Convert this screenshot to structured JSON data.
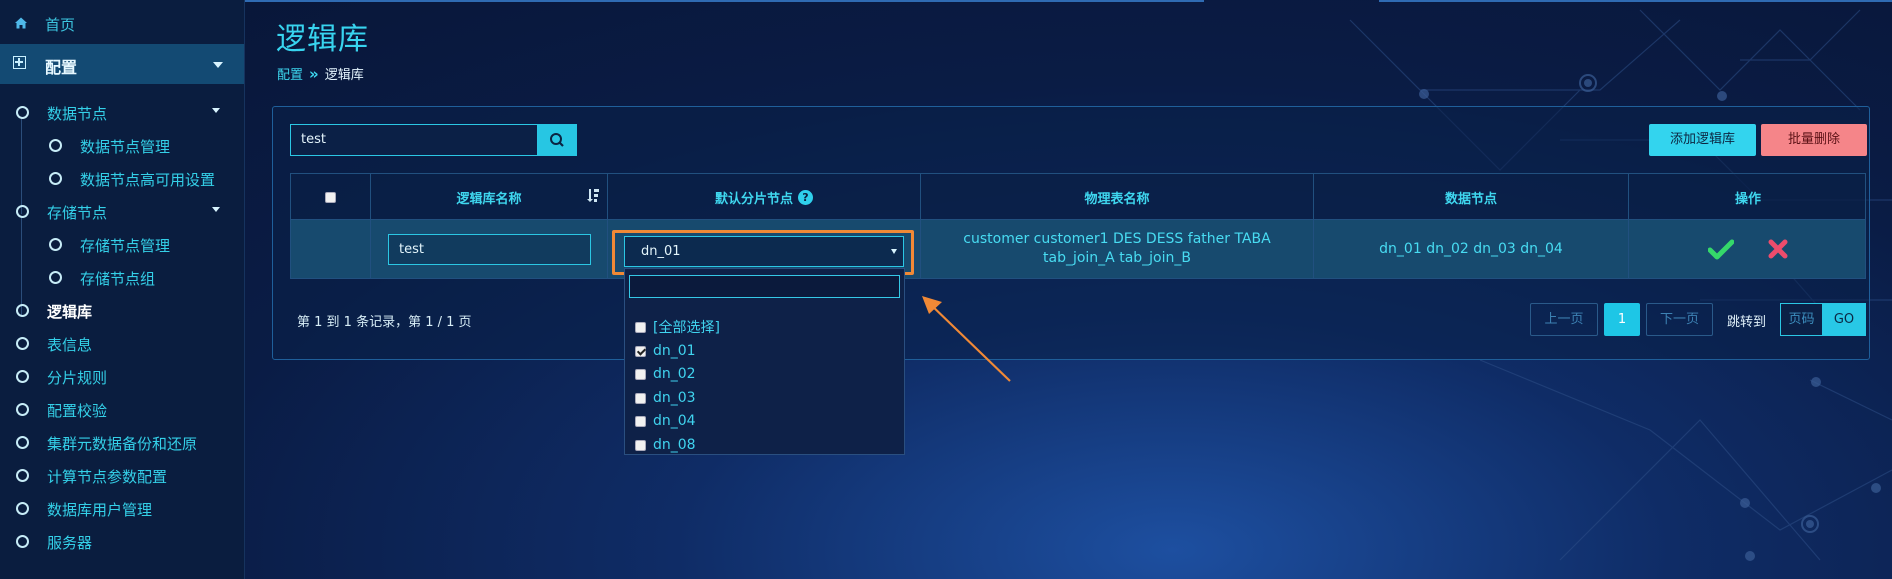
{
  "sidebar": {
    "home": "首页",
    "config": "配置",
    "items": [
      {
        "label": "数据节点",
        "level": 1,
        "expandable": true
      },
      {
        "label": "数据节点管理",
        "level": 2
      },
      {
        "label": "数据节点高可用设置",
        "level": 2
      },
      {
        "label": "存储节点",
        "level": 1,
        "expandable": true
      },
      {
        "label": "存储节点管理",
        "level": 2
      },
      {
        "label": "存储节点组",
        "level": 2
      },
      {
        "label": "逻辑库",
        "level": 1,
        "active": true
      },
      {
        "label": "表信息",
        "level": 1
      },
      {
        "label": "分片规则",
        "level": 1
      },
      {
        "label": "配置校验",
        "level": 1
      },
      {
        "label": "集群元数据备份和还原",
        "level": 1
      },
      {
        "label": "计算节点参数配置",
        "level": 1
      },
      {
        "label": "数据库用户管理",
        "level": 1
      },
      {
        "label": "服务器",
        "level": 1
      }
    ]
  },
  "header": {
    "title": "逻辑库",
    "breadcrumb": [
      "配置",
      "»",
      "逻辑库"
    ]
  },
  "toolbar": {
    "search_value": "test",
    "add_label": "添加逻辑库",
    "delete_label": "批量删除"
  },
  "table": {
    "columns": [
      "",
      "逻辑库名称",
      "默认分片节点",
      "物理表名称",
      "数据节点",
      "操作"
    ],
    "help_icon": "?",
    "row": {
      "name": "test",
      "default_node": "dn_01",
      "tables": "customer customer1 DES DESS father TABA tab_join_A tab_join_B",
      "nodes": "dn_01 dn_02 dn_03 dn_04"
    }
  },
  "dropdown": {
    "search_value": "",
    "options": [
      {
        "label": "[全部选择]",
        "checked": false
      },
      {
        "label": "dn_01",
        "checked": true
      },
      {
        "label": "dn_02",
        "checked": false
      },
      {
        "label": "dn_03",
        "checked": false
      },
      {
        "label": "dn_04",
        "checked": false
      },
      {
        "label": "dn_08",
        "checked": false
      }
    ]
  },
  "footer": {
    "records": "第 1 到 1 条记录，第 1 / 1 页",
    "prev": "上一页",
    "current": "1",
    "next": "下一页",
    "jump_label": "跳转到",
    "page_placeholder": "页码",
    "go": "GO"
  },
  "colors": {
    "accent": "#33d4ee",
    "danger": "#f58589",
    "highlight": "#f08936",
    "confirm": "#35d86a",
    "cancel": "#ee4c6c"
  }
}
